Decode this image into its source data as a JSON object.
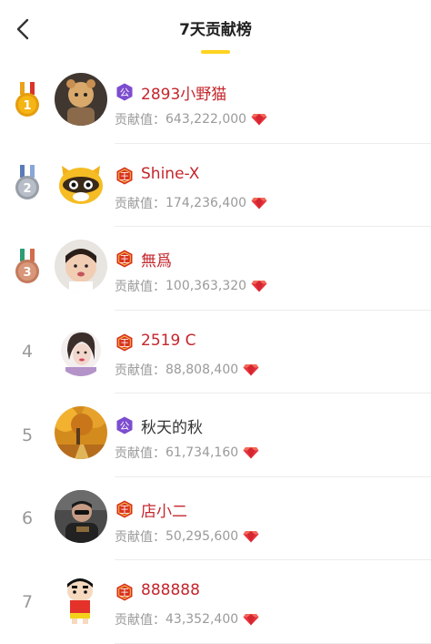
{
  "header": {
    "title": "7天贡献榜"
  },
  "contribution_label": "贡献值：",
  "colors": {
    "accent": "#ffd21f",
    "vip_name": "#c4262c",
    "gem": "#e8313b"
  },
  "rows": [
    {
      "rank": "1",
      "medal": "gold",
      "badge": "公",
      "badge_type": "guild",
      "name": "2893小野猫",
      "value": "643,222,000",
      "avatar_style": "cat-doll"
    },
    {
      "rank": "2",
      "medal": "silver",
      "badge": "王",
      "badge_type": "king",
      "name": "Shine-X",
      "value": "174,236,400",
      "avatar_style": "raccoon"
    },
    {
      "rank": "3",
      "medal": "bronze",
      "badge": "王",
      "badge_type": "king",
      "name": "無爲",
      "value": "100,363,320",
      "avatar_style": "child"
    },
    {
      "rank": "4",
      "medal": "",
      "badge": "王",
      "badge_type": "king",
      "name": "2519 C",
      "value": "88,808,400",
      "avatar_style": "girl-drawing"
    },
    {
      "rank": "5",
      "medal": "",
      "badge": "公",
      "badge_type": "guild",
      "name": "秋天的秋",
      "value": "61,734,160",
      "avatar_style": "autumn"
    },
    {
      "rank": "6",
      "medal": "",
      "badge": "王",
      "badge_type": "king",
      "name": "店小二",
      "value": "50,295,600",
      "avatar_style": "man"
    },
    {
      "rank": "7",
      "medal": "",
      "badge": "王",
      "badge_type": "king",
      "name": "888888",
      "value": "43,352,400",
      "avatar_style": "shinchan"
    }
  ]
}
